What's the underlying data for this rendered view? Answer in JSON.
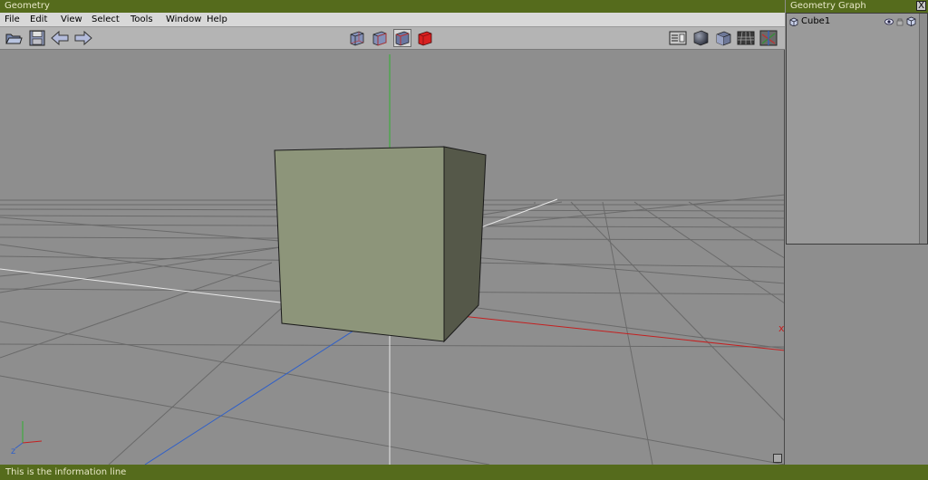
{
  "window": {
    "title": "Geometry"
  },
  "menu": {
    "file": "File",
    "edit": "Edit",
    "view": "View",
    "select": "Select",
    "tools": "Tools",
    "window": "Window",
    "help": "Help"
  },
  "toolbar": {
    "left_icons": [
      "open-folder-icon",
      "save-disk-icon",
      "back-arrow-icon",
      "forward-arrow-icon"
    ],
    "center_icons": [
      "cube-wire-icon",
      "cube-wire-front-icon",
      "cube-wire-selected-icon",
      "cube-solid-red-icon"
    ],
    "right_icons": [
      "settings-panel-icon",
      "shaded-sphere-icon",
      "shaded-cube-icon",
      "grid-icon",
      "axes-icon"
    ]
  },
  "viewport": {
    "x_axis_label": "x",
    "corner_axis_z": "z",
    "cube_color": "#8d957a",
    "axis_colors": {
      "x": "#c42020",
      "y": "#30b030",
      "z": "#3060c8"
    }
  },
  "graph": {
    "title": "Geometry Graph",
    "close": "X",
    "items": [
      {
        "label": "Cube1"
      }
    ]
  },
  "status": {
    "text": "This is the information line"
  },
  "colors": {
    "titlebar": "#556b1c",
    "titletext": "#e8e8c8",
    "background": "#8e8e8e"
  }
}
